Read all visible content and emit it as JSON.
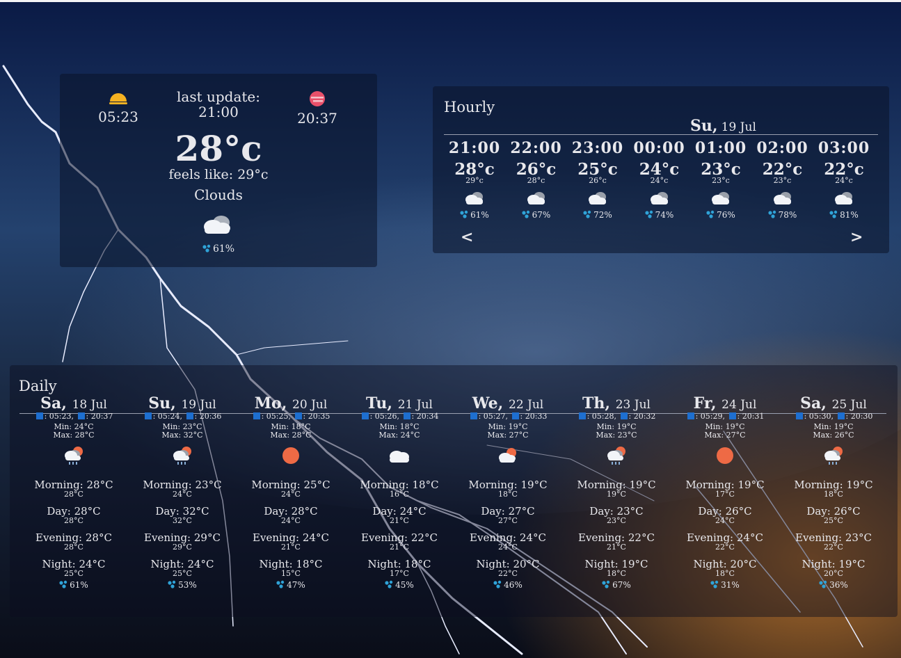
{
  "current": {
    "sunrise": "05:23",
    "sunset": "20:37",
    "last_update_label": "last update:",
    "last_update_time": "21:00",
    "temperature": "28°c",
    "feels_like": "feels like: 29°c",
    "description": "Clouds",
    "humidity": "61%"
  },
  "hourly": {
    "title": "Hourly",
    "day_name": "Su,",
    "day_date": "19 Jul",
    "prev": "<",
    "next": ">",
    "hours": [
      {
        "time": "21:00",
        "temp": "28°c",
        "feels": "29°c",
        "humidity": "61%"
      },
      {
        "time": "22:00",
        "temp": "26°c",
        "feels": "28°c",
        "humidity": "67%"
      },
      {
        "time": "23:00",
        "temp": "25°c",
        "feels": "26°c",
        "humidity": "72%"
      },
      {
        "time": "00:00",
        "temp": "24°c",
        "feels": "24°c",
        "humidity": "74%"
      },
      {
        "time": "01:00",
        "temp": "23°c",
        "feels": "23°c",
        "humidity": "76%"
      },
      {
        "time": "02:00",
        "temp": "22°c",
        "feels": "23°c",
        "humidity": "78%"
      },
      {
        "time": "03:00",
        "temp": "22°c",
        "feels": "24°c",
        "humidity": "81%"
      }
    ]
  },
  "daily": {
    "title": "Daily",
    "days": [
      {
        "name": "Sa,",
        "date": "18 Jul",
        "sunrise": ": 05:23,",
        "sunset": ": 20:37",
        "min": "Min: 24°C",
        "max": "Max: 28°C",
        "icon": "rain-sun-icon",
        "morning": "Morning: 28°C",
        "morning_f": "28°C",
        "day": "Day: 28°C",
        "day_f": "28°C",
        "evening": "Evening: 28°C",
        "evening_f": "28°C",
        "night": "Night: 24°C",
        "night_f": "25°C",
        "humidity": "61%"
      },
      {
        "name": "Su,",
        "date": "19 Jul",
        "sunrise": ": 05:24,",
        "sunset": ": 20:36",
        "min": "Min: 23°C",
        "max": "Max: 32°C",
        "icon": "rain-sun-icon",
        "morning": "Morning: 23°C",
        "morning_f": "24°C",
        "day": "Day: 32°C",
        "day_f": "32°C",
        "evening": "Evening: 29°C",
        "evening_f": "29°C",
        "night": "Night: 24°C",
        "night_f": "25°C",
        "humidity": "53%"
      },
      {
        "name": "Mo,",
        "date": "20 Jul",
        "sunrise": ": 05:25,",
        "sunset": ": 20:35",
        "min": "Min: 18°C",
        "max": "Max: 28°C",
        "icon": "sun-icon",
        "morning": "Morning: 25°C",
        "morning_f": "24°C",
        "day": "Day: 28°C",
        "day_f": "24°C",
        "evening": "Evening: 24°C",
        "evening_f": "21°C",
        "night": "Night: 18°C",
        "night_f": "15°C",
        "humidity": "47%"
      },
      {
        "name": "Tu,",
        "date": "21 Jul",
        "sunrise": ": 05:26,",
        "sunset": ": 20:34",
        "min": "Min: 18°C",
        "max": "Max: 24°C",
        "icon": "cloud-icon",
        "morning": "Morning: 18°C",
        "morning_f": "16°C",
        "day": "Day: 24°C",
        "day_f": "21°C",
        "evening": "Evening: 22°C",
        "evening_f": "21°C",
        "night": "Night: 18°C",
        "night_f": "17°C",
        "humidity": "45%"
      },
      {
        "name": "We,",
        "date": "22 Jul",
        "sunrise": ": 05:27,",
        "sunset": ": 20:33",
        "min": "Min: 19°C",
        "max": "Max: 27°C",
        "icon": "sun-cloud-icon",
        "morning": "Morning: 19°C",
        "morning_f": "18°C",
        "day": "Day: 27°C",
        "day_f": "27°C",
        "evening": "Evening: 24°C",
        "evening_f": "24°C",
        "night": "Night: 20°C",
        "night_f": "22°C",
        "humidity": "46%"
      },
      {
        "name": "Th,",
        "date": "23 Jul",
        "sunrise": ": 05:28,",
        "sunset": ": 20:32",
        "min": "Min: 19°C",
        "max": "Max: 23°C",
        "icon": "rain-sun-icon",
        "morning": "Morning: 19°C",
        "morning_f": "19°C",
        "day": "Day: 23°C",
        "day_f": "23°C",
        "evening": "Evening: 22°C",
        "evening_f": "21°C",
        "night": "Night: 19°C",
        "night_f": "18°C",
        "humidity": "67%"
      },
      {
        "name": "Fr,",
        "date": "24 Jul",
        "sunrise": ": 05:29,",
        "sunset": ": 20:31",
        "min": "Min: 19°C",
        "max": "Max: 27°C",
        "icon": "sun-icon",
        "morning": "Morning: 19°C",
        "morning_f": "17°C",
        "day": "Day: 26°C",
        "day_f": "24°C",
        "evening": "Evening: 24°C",
        "evening_f": "22°C",
        "night": "Night: 20°C",
        "night_f": "18°C",
        "humidity": "31%"
      },
      {
        "name": "Sa,",
        "date": "25 Jul",
        "sunrise": ": 05:30,",
        "sunset": ": 20:30",
        "min": "Min: 19°C",
        "max": "Max: 26°C",
        "icon": "rain-sun-icon",
        "morning": "Morning: 19°C",
        "morning_f": "18°C",
        "day": "Day: 26°C",
        "day_f": "25°C",
        "evening": "Evening: 23°C",
        "evening_f": "22°C",
        "night": "Night: 19°C",
        "night_f": "20°C",
        "humidity": "36%"
      }
    ]
  },
  "colors": {
    "sun": "#ee6a45",
    "sunrise_icon": "#f5b221",
    "sunset_icon": "#e8506a",
    "drop": "#2fa3d8",
    "arrow_box": "#1e6fd0"
  }
}
